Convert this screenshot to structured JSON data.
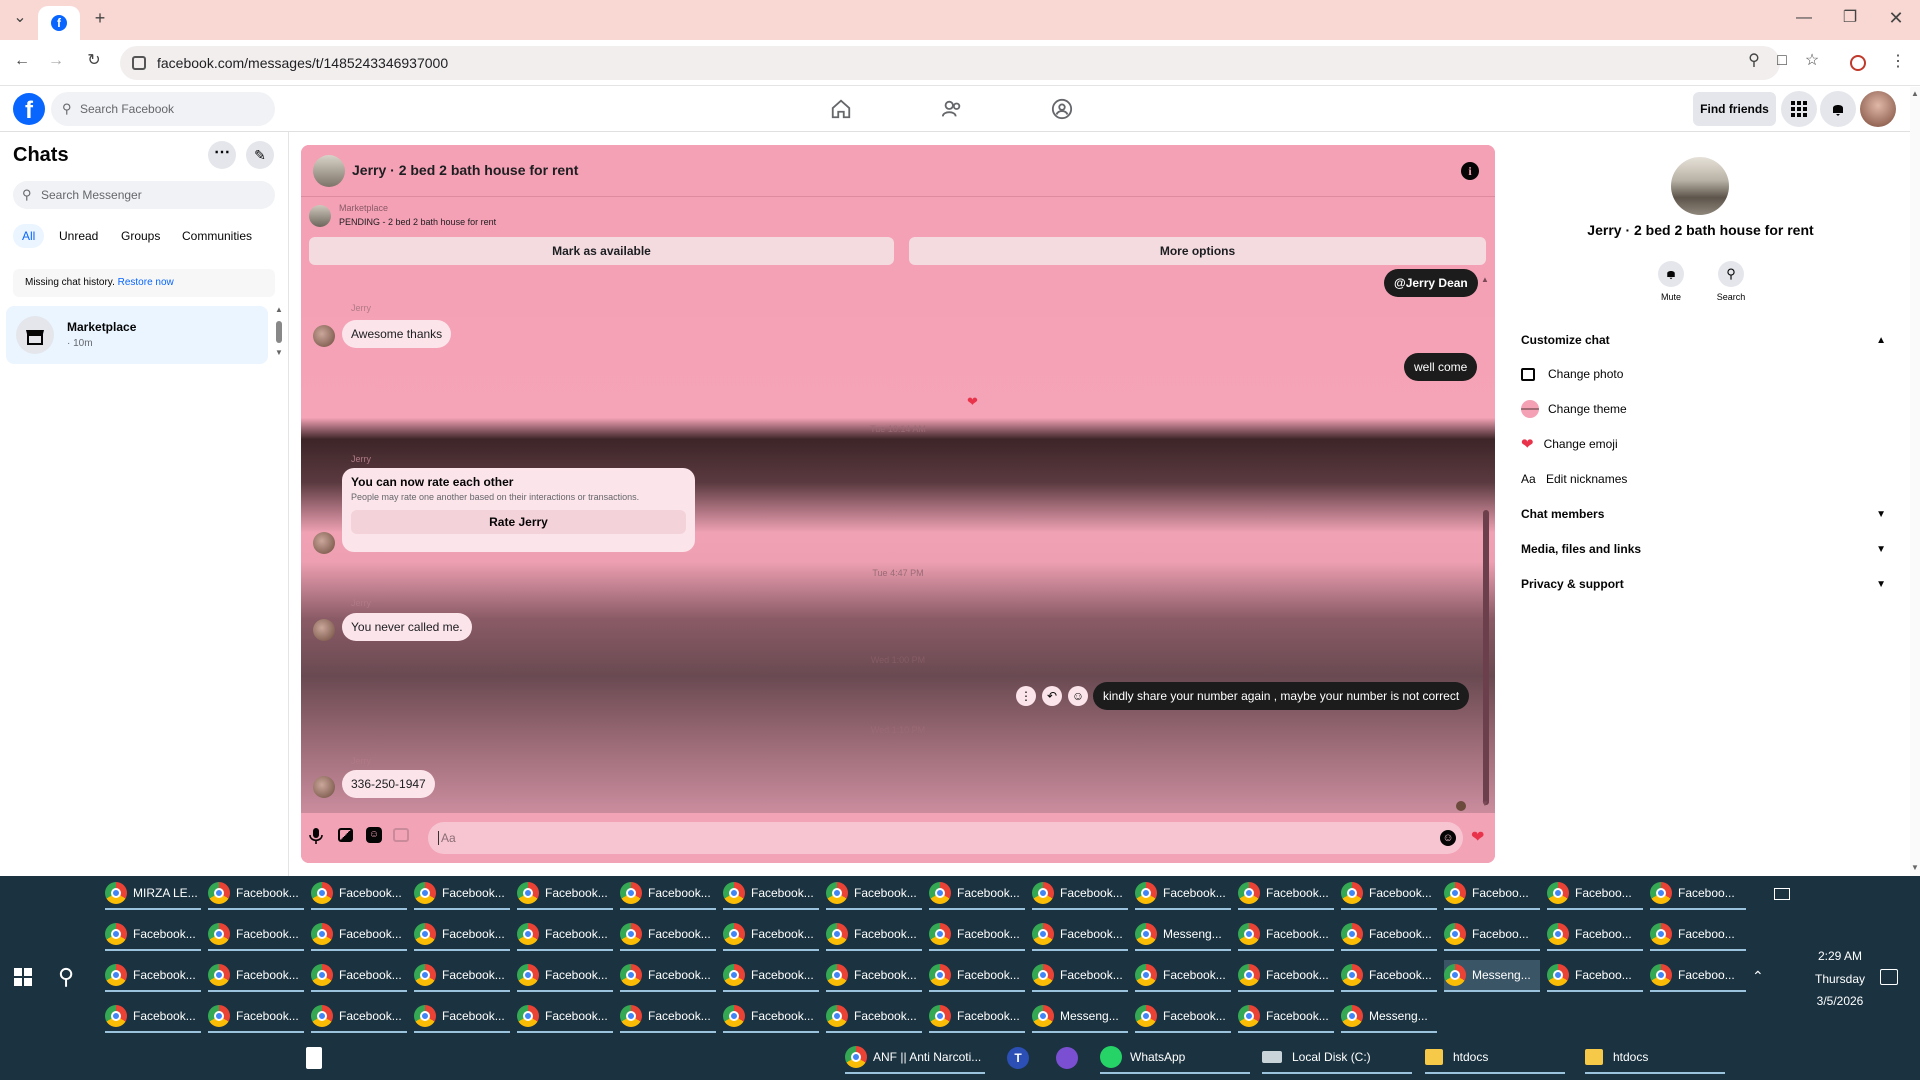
{
  "browser": {
    "url": "facebook.com/messages/t/1485243346937000",
    "new_tab": "+"
  },
  "fb_header": {
    "search_placeholder": "Search Facebook",
    "find_friends": "Find friends"
  },
  "sidebar": {
    "title": "Chats",
    "search_placeholder": "Search Messenger",
    "filters": [
      "All",
      "Unread",
      "Groups",
      "Communities"
    ],
    "notice_text": "Missing chat history.",
    "notice_link": "Restore now",
    "chats": [
      {
        "name": "Marketplace",
        "meta": "· 10m"
      }
    ]
  },
  "chat": {
    "title": "Jerry · 2 bed 2 bath house for rent",
    "marketplace_label": "Marketplace",
    "listing_status": "PENDING - 2 bed 2 bath house for rent",
    "mark_available": "Mark as available",
    "more_options": "More options",
    "mention": "@Jerry Dean",
    "messages": {
      "m1_sender": "Jerry",
      "m1_text": "Awesome thanks",
      "m2_text": "well come",
      "stamp1": "Tue 10:14 AM",
      "m3_sender": "Jerry",
      "rate_title": "You can now rate each other",
      "rate_desc": "People may rate one another based on their interactions or transactions.",
      "rate_button": "Rate Jerry",
      "stamp2": "Tue 4:47 PM",
      "m4_sender": "Jerry",
      "m4_text": "You never called me.",
      "stamp3": "Wed 1:00 PM",
      "m5_text": "kindly share your number again  , maybe your number is not correct",
      "stamp4": "Wed 1:10 PM",
      "m6_sender": "Jerry",
      "m6_text": "336-250-1947"
    },
    "composer_placeholder": "Aa"
  },
  "right_panel": {
    "title": "Jerry · 2 bed 2 bath house for rent",
    "mute": "Mute",
    "search": "Search",
    "customize": "Customize chat",
    "change_photo": "Change photo",
    "change_theme": "Change theme",
    "change_emoji": "Change emoji",
    "edit_nicknames": "Edit nicknames",
    "chat_members": "Chat members",
    "media": "Media, files and links",
    "privacy": "Privacy & support",
    "aa_glyph": "Aa"
  },
  "taskbar": {
    "row1": [
      "MIRZA LE...",
      "Facebook...",
      "Facebook...",
      "Facebook...",
      "Facebook...",
      "Facebook...",
      "Facebook...",
      "Facebook...",
      "Facebook...",
      "Facebook...",
      "Facebook...",
      "Facebook...",
      "Facebook...",
      "Faceboo...",
      "Faceboo...",
      "Faceboo..."
    ],
    "row2": [
      "Facebook...",
      "Facebook...",
      "Facebook...",
      "Facebook...",
      "Facebook...",
      "Facebook...",
      "Facebook...",
      "Facebook...",
      "Facebook...",
      "Facebook...",
      "Messeng...",
      "Facebook...",
      "Facebook...",
      "Faceboo...",
      "Faceboo...",
      "Faceboo..."
    ],
    "row3": [
      "Facebook...",
      "Facebook...",
      "Facebook...",
      "Facebook...",
      "Facebook...",
      "Facebook...",
      "Facebook...",
      "Facebook...",
      "Facebook...",
      "Facebook...",
      "Facebook...",
      "Facebook...",
      "Facebook...",
      "Messeng...",
      "Faceboo...",
      "Faceboo..."
    ],
    "row4": [
      "Facebook...",
      "Facebook...",
      "Facebook...",
      "Facebook...",
      "Facebook...",
      "Facebook...",
      "Facebook...",
      "Facebook...",
      "Facebook...",
      "Messeng...",
      "Facebook...",
      "Facebook...",
      "Messeng..."
    ],
    "row5_labels": {
      "anf": "ANF || Anti Narcoti...",
      "whatsapp": "WhatsApp",
      "localdisk": "Local Disk (C:)",
      "htdocs1": "htdocs",
      "htdocs2": "htdocs"
    },
    "time": "2:29 AM",
    "day": "Thursday",
    "date": "3/5/2026"
  }
}
